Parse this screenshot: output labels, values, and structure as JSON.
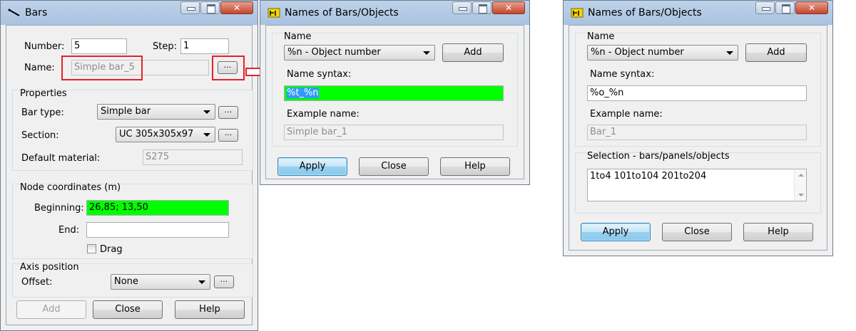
{
  "bars_dialog": {
    "title": "Bars",
    "number_label": "Number:",
    "number_value": "5",
    "step_label": "Step:",
    "step_value": "1",
    "name_label": "Name:",
    "name_value": "Simple bar_5",
    "name_browse": "...",
    "properties": {
      "title": "Properties",
      "bar_type_label": "Bar type:",
      "bar_type_value": "Simple bar",
      "bar_type_browse": "...",
      "section_label": "Section:",
      "section_value": "UC 305x305x97",
      "section_browse": "...",
      "material_label": "Default material:",
      "material_value": "S275"
    },
    "node_coordinates": {
      "title": "Node coordinates (m)",
      "beginning_label": "Beginning:",
      "beginning_value": "26,85; 13,50",
      "end_label": "End:",
      "end_value": "",
      "drag_label": "Drag"
    },
    "axis_position": {
      "title": "Axis position",
      "offset_label": "Offset:",
      "offset_value": "None",
      "offset_browse": "..."
    },
    "add_button": "Add",
    "close_button": "Close",
    "help_button": "Help"
  },
  "names_dialog_1": {
    "title": "Names of Bars/Objects",
    "group_title": "Name",
    "combo_value": "%n - Object number",
    "add_button": "Add",
    "syntax_label": "Name syntax:",
    "syntax_value": "%t_%n",
    "example_label": "Example name:",
    "example_value": "Simple bar_1",
    "apply_button": "Apply",
    "close_button": "Close",
    "help_button": "Help"
  },
  "names_dialog_2": {
    "title": "Names of Bars/Objects",
    "group_title": "Name",
    "combo_value": "%n - Object number",
    "add_button": "Add",
    "syntax_label": "Name syntax:",
    "syntax_value": "%o_%n",
    "example_label": "Example name:",
    "example_value": "Bar_1",
    "selection_title": "Selection - bars/panels/objects",
    "selection_value": "1to4 101to104 201to204",
    "apply_button": "Apply",
    "close_button": "Close",
    "help_button": "Help"
  },
  "colors": {
    "highlight_green": "#00ff00",
    "annotation_red": "#e8202a",
    "selection_blue": "#3399ff"
  }
}
